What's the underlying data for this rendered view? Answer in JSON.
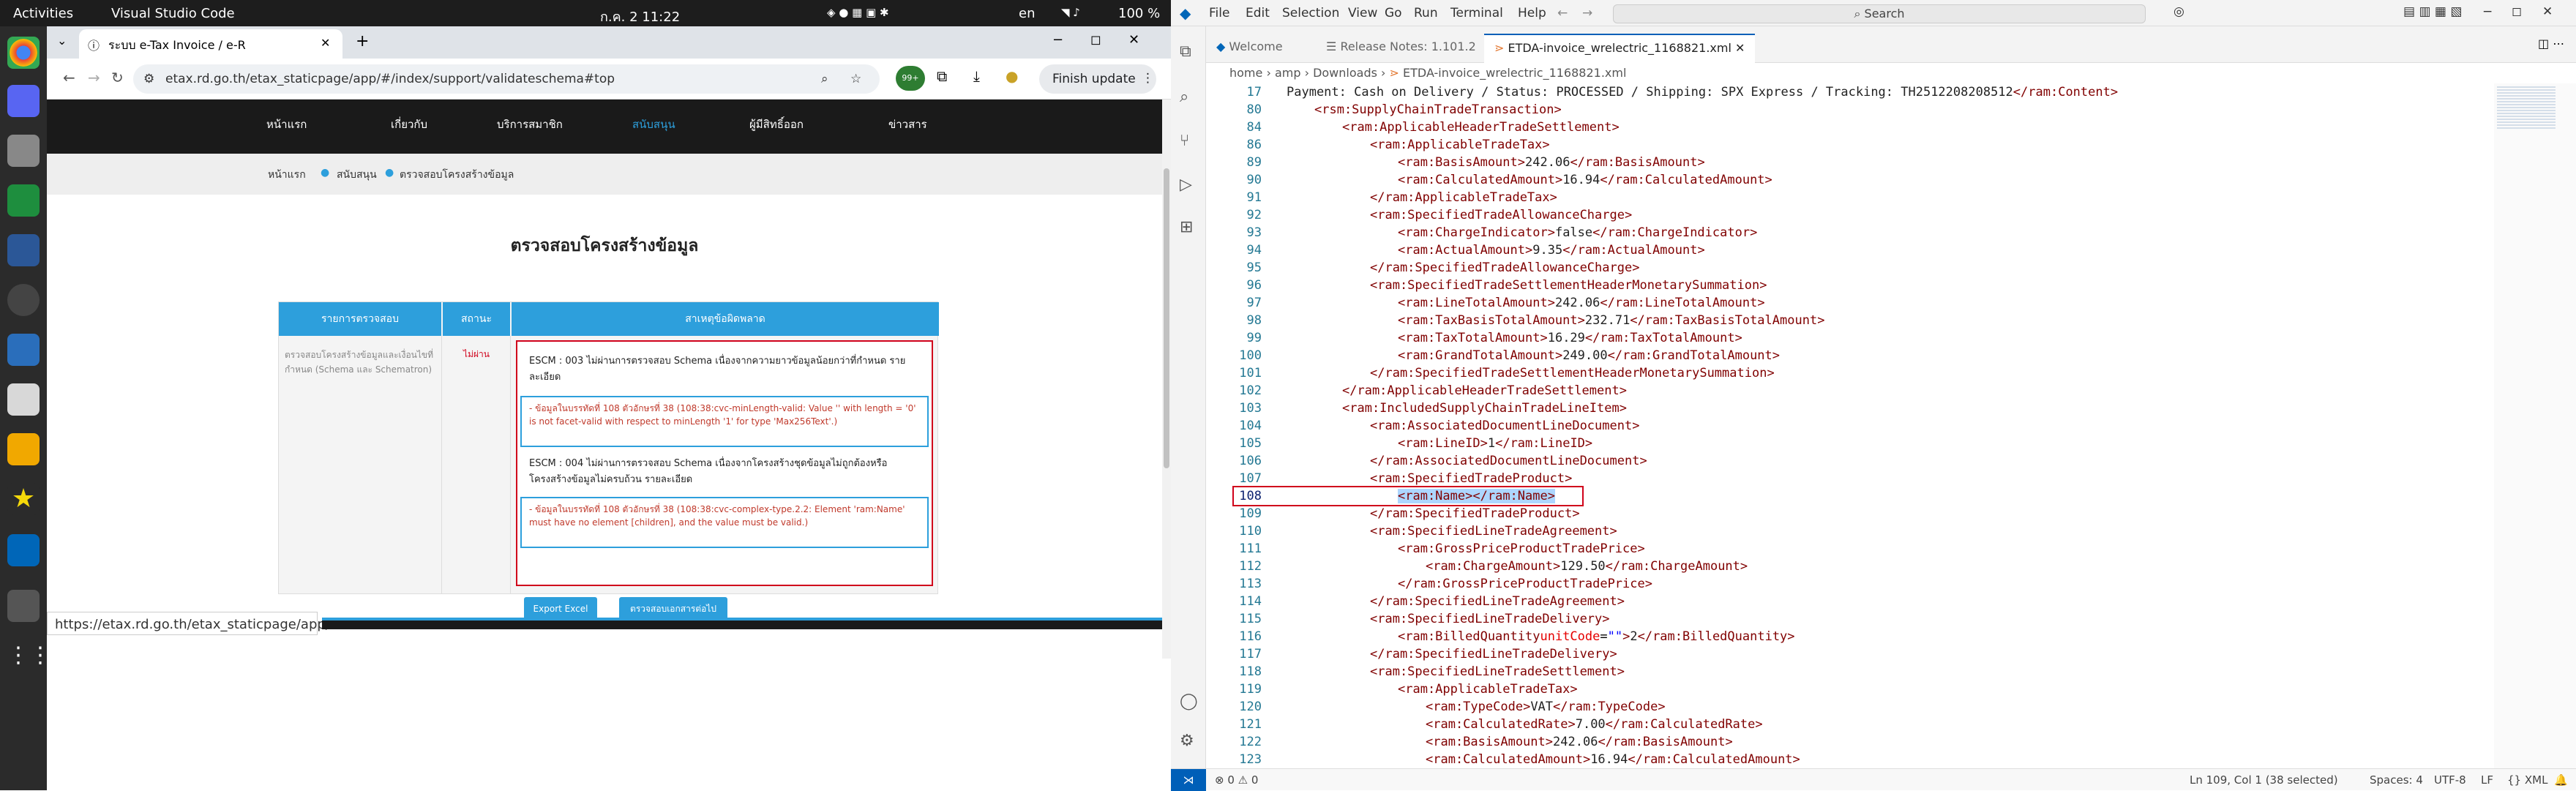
{
  "topbar": {
    "activities": "Activities",
    "app": "Visual Studio Code",
    "clock": "ก.ค. 2  11:22",
    "lang": "en",
    "battery": "100 %"
  },
  "browser": {
    "tab_title": "ระบบ e-Tax Invoice / e-R",
    "url": "etax.rd.go.th/etax_staticpage/app/#/index/support/validateschema#top",
    "finish_update": "Finish update",
    "ext_badge": "99+",
    "site_nav": [
      "หน้าแรก",
      "เกี่ยวกับ",
      "บริการสมาชิก",
      "สนับสนุน",
      "ผู้มีสิทธิ์ออก",
      "ข่าวสาร"
    ],
    "breadcrumb": [
      "หน้าแรก",
      "สนับสนุน",
      "ตรวจสอบโครงสร้างข้อมูล"
    ],
    "page_title": "ตรวจสอบโครงสร้างข้อมูล",
    "table": {
      "headers": [
        "รายการตรวจสอบ",
        "สถานะ",
        "สาเหตุข้อผิดพลาด"
      ],
      "item": "ตรวจสอบโครงสร้างข้อมูลและเงื่อนไขที่กำหนด (Schema และ Schematron)",
      "status": "ไม่ผ่าน",
      "errors": [
        {
          "head": "ESCM : 003 ไม่ผ่านการตรวจสอบ Schema เนื่องจากความยาวข้อมูลน้อยกว่าที่กำหนด รายละเอียด",
          "detail": "- ข้อมูลในบรรทัดที่ 108 ตัวอักษรที่ 38 (108:38:cvc-minLength-valid: Value '' with length = '0' is not facet-valid with respect to minLength '1' for type 'Max256Text'.)"
        },
        {
          "head": "ESCM : 004 ไม่ผ่านการตรวจสอบ Schema เนื่องจากโครงสร้างชุดข้อมูลไม่ถูกต้องหรือโครงสร้างข้อมูลไม่ครบถ้วน รายละเอียด",
          "detail": "- ข้อมูลในบรรทัดที่ 108 ตัวอักษรที่ 38 (108:38:cvc-complex-type.2.2: Element 'ram:Name' must have no element [children], and the value must be valid.)"
        }
      ]
    },
    "btn_export": "Export Excel",
    "btn_check_other": "ตรวจสอบเอกสารต่อไป",
    "status_url": "https://etax.rd.go.th/etax_staticpage/app/"
  },
  "vscode": {
    "menu": [
      "File",
      "Edit",
      "Selection",
      "View",
      "Go",
      "Run",
      "Terminal",
      "Help"
    ],
    "search": "Search",
    "tabs": [
      "Welcome",
      "Release Notes: 1.101.2",
      "ETDA-invoice_wrelectric_1168821.xml"
    ],
    "breadcrumb": [
      "home",
      "amp",
      "Downloads",
      "ETDA-invoice_wrelectric_1168821.xml"
    ],
    "lines": [
      {
        "n": "17",
        "i": 0,
        "t": "Payment: Cash on Delivery / Status: PROCESSED / Shipping: SPX Express / Tracking: TH2512208208512</ram:Content>"
      },
      {
        "n": "80",
        "i": 1,
        "t": "<rsm:SupplyChainTradeTransaction>"
      },
      {
        "n": "84",
        "i": 2,
        "t": "<ram:ApplicableHeaderTradeSettlement>"
      },
      {
        "n": "86",
        "i": 3,
        "t": "<ram:ApplicableTradeTax>"
      },
      {
        "n": "89",
        "i": 4,
        "t": "<ram:BasisAmount>242.06</ram:BasisAmount>"
      },
      {
        "n": "90",
        "i": 4,
        "t": "<ram:CalculatedAmount>16.94</ram:CalculatedAmount>"
      },
      {
        "n": "91",
        "i": 3,
        "t": "</ram:ApplicableTradeTax>"
      },
      {
        "n": "92",
        "i": 3,
        "t": "<ram:SpecifiedTradeAllowanceCharge>"
      },
      {
        "n": "93",
        "i": 4,
        "t": "<ram:ChargeIndicator>false</ram:ChargeIndicator>"
      },
      {
        "n": "94",
        "i": 4,
        "t": "<ram:ActualAmount>9.35</ram:ActualAmount>"
      },
      {
        "n": "95",
        "i": 3,
        "t": "</ram:SpecifiedTradeAllowanceCharge>"
      },
      {
        "n": "96",
        "i": 3,
        "t": "<ram:SpecifiedTradeSettlementHeaderMonetarySummation>"
      },
      {
        "n": "97",
        "i": 4,
        "t": "<ram:LineTotalAmount>242.06</ram:LineTotalAmount>"
      },
      {
        "n": "98",
        "i": 4,
        "t": "<ram:TaxBasisTotalAmount>232.71</ram:TaxBasisTotalAmount>"
      },
      {
        "n": "99",
        "i": 4,
        "t": "<ram:TaxTotalAmount>16.29</ram:TaxTotalAmount>"
      },
      {
        "n": "100",
        "i": 4,
        "t": "<ram:GrandTotalAmount>249.00</ram:GrandTotalAmount>"
      },
      {
        "n": "101",
        "i": 3,
        "t": "</ram:SpecifiedTradeSettlementHeaderMonetarySummation>"
      },
      {
        "n": "102",
        "i": 2,
        "t": "</ram:ApplicableHeaderTradeSettlement>"
      },
      {
        "n": "103",
        "i": 2,
        "t": "<ram:IncludedSupplyChainTradeLineItem>"
      },
      {
        "n": "104",
        "i": 3,
        "t": "<ram:AssociatedDocumentLineDocument>"
      },
      {
        "n": "105",
        "i": 4,
        "t": "<ram:LineID>1</ram:LineID>"
      },
      {
        "n": "106",
        "i": 3,
        "t": "</ram:AssociatedDocumentLineDocument>"
      },
      {
        "n": "107",
        "i": 3,
        "t": "<ram:SpecifiedTradeProduct>"
      },
      {
        "n": "108",
        "i": 4,
        "t": "<ram:Name></ram:Name>"
      },
      {
        "n": "109",
        "i": 3,
        "t": "</ram:SpecifiedTradeProduct>"
      },
      {
        "n": "110",
        "i": 3,
        "t": "<ram:SpecifiedLineTradeAgreement>"
      },
      {
        "n": "111",
        "i": 4,
        "t": "<ram:GrossPriceProductTradePrice>"
      },
      {
        "n": "112",
        "i": 5,
        "t": "<ram:ChargeAmount>129.50</ram:ChargeAmount>"
      },
      {
        "n": "113",
        "i": 4,
        "t": "</ram:GrossPriceProductTradePrice>"
      },
      {
        "n": "114",
        "i": 3,
        "t": "</ram:SpecifiedLineTradeAgreement>"
      },
      {
        "n": "115",
        "i": 3,
        "t": "<ram:SpecifiedLineTradeDelivery>"
      },
      {
        "n": "116",
        "i": 4,
        "t": "<ram:BilledQuantity unitCode=\"\">2</ram:BilledQuantity>"
      },
      {
        "n": "117",
        "i": 3,
        "t": "</ram:SpecifiedLineTradeDelivery>"
      },
      {
        "n": "118",
        "i": 3,
        "t": "<ram:SpecifiedLineTradeSettlement>"
      },
      {
        "n": "119",
        "i": 4,
        "t": "<ram:ApplicableTradeTax>"
      },
      {
        "n": "120",
        "i": 5,
        "t": "<ram:TypeCode>VAT</ram:TypeCode>"
      },
      {
        "n": "121",
        "i": 5,
        "t": "<ram:CalculatedRate>7.00</ram:CalculatedRate>"
      },
      {
        "n": "122",
        "i": 5,
        "t": "<ram:BasisAmount>242.06</ram:BasisAmount>"
      },
      {
        "n": "123",
        "i": 5,
        "t": "<ram:CalculatedAmount>16.94</ram:CalculatedAmount>"
      },
      {
        "n": "124",
        "i": 4,
        "t": "</ram:ApplicableTradeTax>"
      }
    ],
    "status_left": "⊗ 0 ⚠ 0",
    "status_pos": "Ln 109, Col 1 (38 selected)",
    "status_spaces": "Spaces: 4",
    "status_enc": "UTF-8",
    "status_eol": "LF",
    "status_lang": "{} XML"
  },
  "colors": {
    "accent": "#2d9fdc",
    "error": "#d0021b",
    "vscode_blue": "#005fb8"
  }
}
